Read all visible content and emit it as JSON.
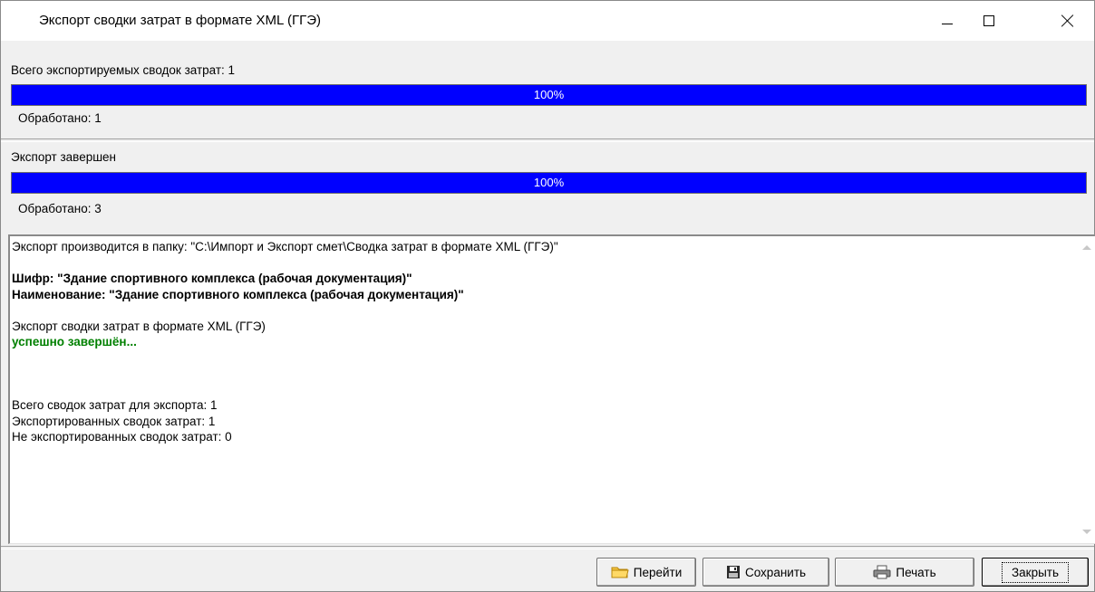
{
  "window": {
    "title": "Экспорт сводки затрат в формате XML (ГГЭ)"
  },
  "progress1": {
    "label": "Всего экспортируемых сводок затрат: 1",
    "percent_text": "100%",
    "value": 1.0,
    "processed_label": "Обработано:",
    "processed_value": "1"
  },
  "progress2": {
    "label": "Экспорт завершен",
    "percent_text": "100%",
    "value": 1.0,
    "processed_label": "Обработано:",
    "processed_value": "3"
  },
  "log": {
    "folder_line": "Экспорт производится в папку: \"C:\\Импорт и Экспорт смет\\Сводка затрат в формате XML (ГГЭ)\"",
    "cipher_line": "Шифр: \"Здание спортивного комплекса (рабочая документация)\"",
    "name_line": "Наименование: \"Здание спортивного комплекса (рабочая документация)\"",
    "export_line": "Экспорт сводки затрат в формате XML (ГГЭ)",
    "success_line": "успешно завершён...",
    "total_line": "Всего сводок затрат для экспорта: 1",
    "exported_line": "Экспортированных сводок затрат: 1",
    "not_exported_line": "Не экспортированных сводок затрат: 0"
  },
  "buttons": {
    "go_label": "Перейти",
    "save_label": "Сохранить",
    "print_label": "Печать",
    "close_label": "Закрыть"
  },
  "icons": {
    "go": "folder-icon",
    "save": "floppy-disk-icon",
    "print": "printer-icon"
  },
  "colors": {
    "progress": "#0000ff",
    "success_text": "#008000"
  }
}
